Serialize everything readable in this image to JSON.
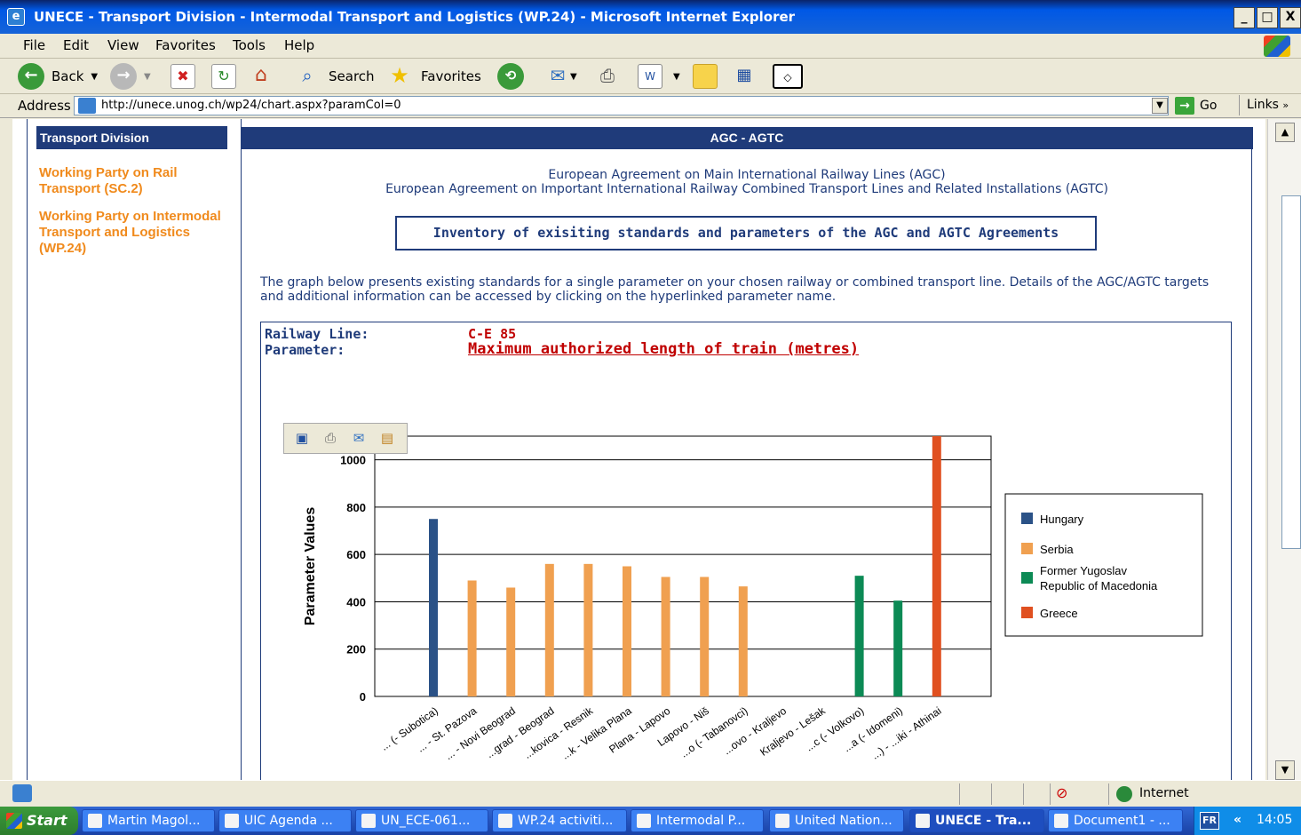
{
  "window": {
    "title": "UNECE - Transport Division - Intermodal Transport and Logistics (WP.24) - Microsoft Internet Explorer",
    "min": "_",
    "max": "□",
    "close": "X"
  },
  "menu": [
    "File",
    "Edit",
    "View",
    "Favorites",
    "Tools",
    "Help"
  ],
  "toolbar": {
    "back": "Back",
    "search": "Search",
    "favorites": "Favorites"
  },
  "address": {
    "label": "Address",
    "url": "http://unece.unog.ch/wp24/chart.aspx?paramCol=0",
    "go": "Go",
    "links": "Links"
  },
  "sidebar": {
    "header": "Transport Division",
    "items": [
      {
        "label": "Working Party on Rail Transport (SC.2)"
      },
      {
        "label": "Working Party on Intermodal Transport and Logistics (WP.24)"
      }
    ]
  },
  "main": {
    "header": "AGC - AGTC",
    "line1": "European Agreement on Main International Railway Lines (AGC)",
    "line2": "European Agreement on Important International Railway Combined Transport Lines and Related Installations (AGTC)",
    "inventory_title": "Inventory of exisiting standards and parameters of the AGC and AGTC Agreements",
    "description": "The graph below presents existing standards for a single parameter on your chosen railway or combined transport line.  Details of the AGC/AGTC targets and additional information can be accessed by clicking on the hyperlinked parameter name.",
    "railway_line_label": "Railway Line:",
    "railway_line_value": "C-E 85",
    "parameter_label": "Parameter:",
    "parameter_value": "Maximum authorized length of train (metres)"
  },
  "chart_data": {
    "type": "bar",
    "ylabel": "Parameter Values",
    "ylim": [
      0,
      1100
    ],
    "yticks": [
      0,
      200,
      400,
      600,
      800,
      1000
    ],
    "grid": true,
    "legend_position": "right",
    "categories": [
      "... (- Subotica)",
      "... - St. Pazova",
      "... - Novi Beograd",
      "...grad - Beograd",
      "...kovica - Resnik",
      "...k - Velika Plana",
      "Plana - Lapovo",
      "Lapovo - Niš",
      "...o (- Tabanovci)",
      "...ovo - Kraljevo",
      "Kraljevo - Lešak",
      "...c (- Volkovo)",
      "...a (- Idomeni)",
      "...) - ...iki - Athinai"
    ],
    "series": [
      {
        "name": "Hungary",
        "color": "#2b5287",
        "values": [
          750,
          null,
          null,
          null,
          null,
          null,
          null,
          null,
          null,
          null,
          null,
          null,
          null,
          null
        ]
      },
      {
        "name": "Serbia",
        "color": "#f0a050",
        "values": [
          null,
          490,
          460,
          560,
          560,
          550,
          505,
          505,
          465,
          null,
          null,
          null,
          null,
          null
        ]
      },
      {
        "name": "Former Yugoslav Republic of Macedonia",
        "color": "#0c8a55",
        "values": [
          null,
          null,
          null,
          null,
          null,
          null,
          null,
          null,
          null,
          null,
          null,
          510,
          405,
          null
        ]
      },
      {
        "name": "Greece",
        "color": "#e05020",
        "values": [
          null,
          null,
          null,
          null,
          null,
          null,
          null,
          null,
          null,
          null,
          null,
          null,
          null,
          1100
        ]
      }
    ]
  },
  "legend_lines": {
    "s0": [
      "Hungary"
    ],
    "s1": [
      "Serbia"
    ],
    "s2": [
      "Former Yugoslav",
      "Republic of Macedonia"
    ],
    "s3": [
      "Greece"
    ]
  },
  "status": {
    "zone": "Internet"
  },
  "taskbar": {
    "start": "Start",
    "tasks": [
      "Martin Magol...",
      "UIC Agenda ...",
      "UN_ECE-061...",
      "WP.24 activiti...",
      "Intermodal P...",
      "United Nation...",
      "UNECE - Tra...",
      "Document1 - ..."
    ],
    "lang": "FR",
    "time": "14:05"
  }
}
